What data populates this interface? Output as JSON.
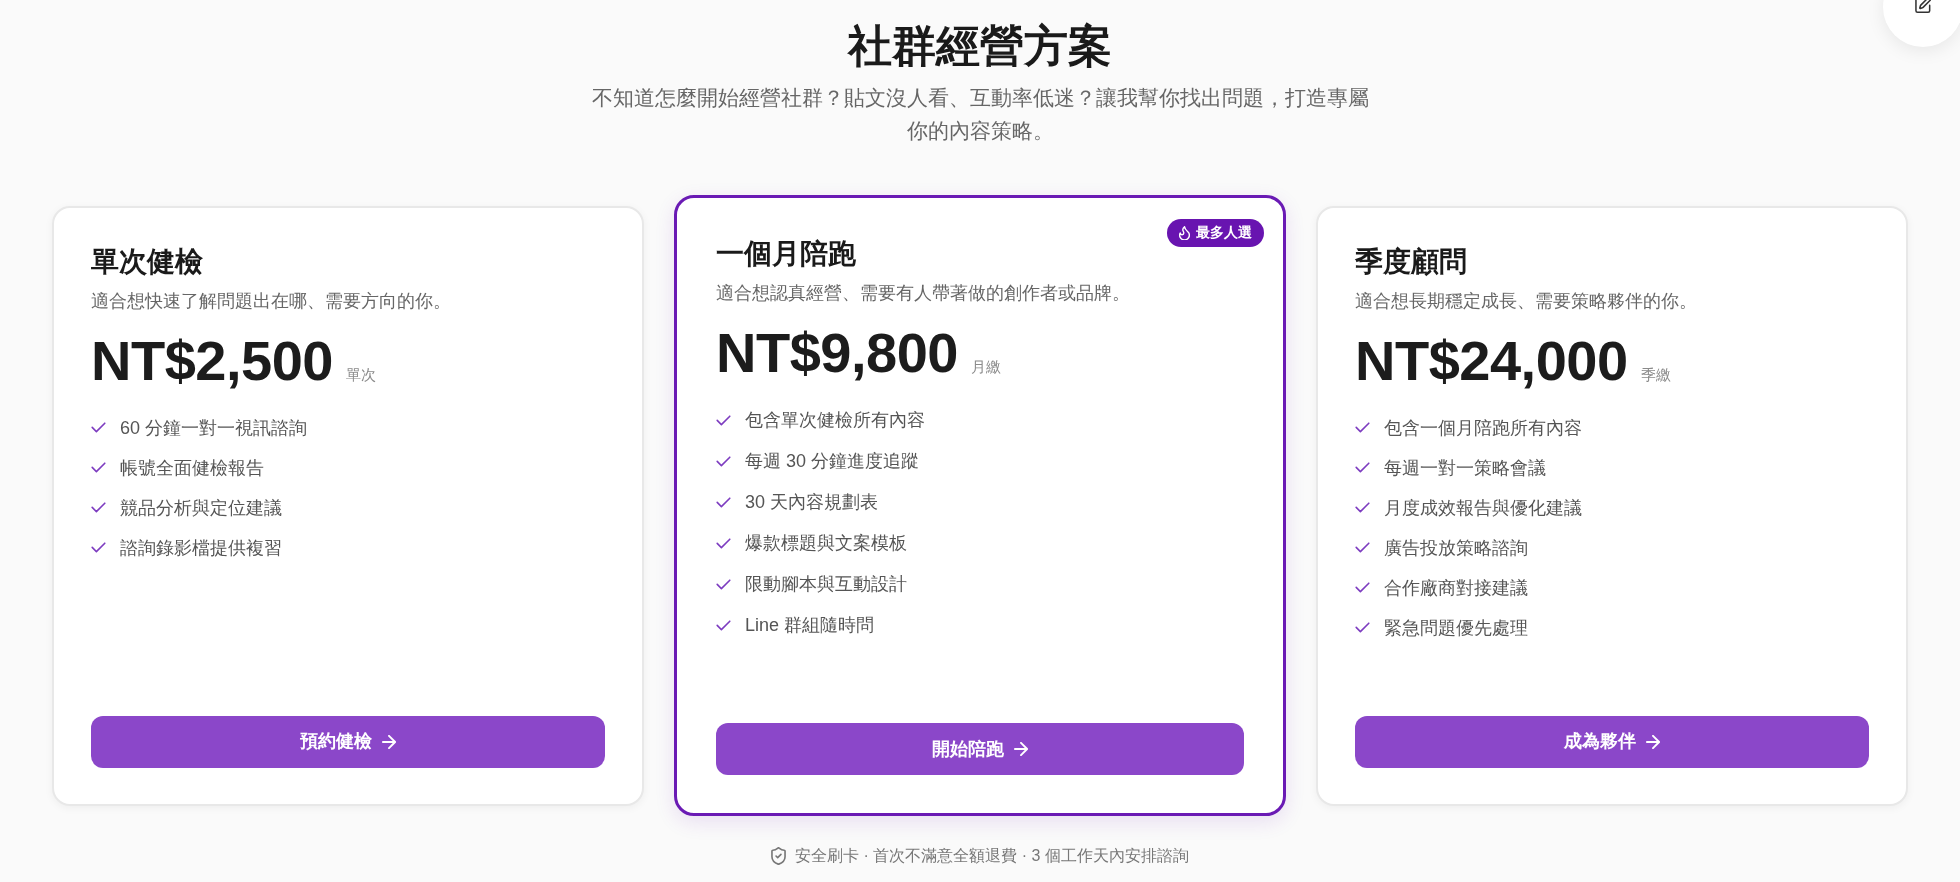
{
  "header": {
    "title": "社群經營方案",
    "subtitle": "不知道怎麼開始經營社群？貼文沒人看、互動率低迷？讓我幫你找出問題，打造專屬你的內容策略。"
  },
  "plans": [
    {
      "name": "單次健檢",
      "description": "適合想快速了解問題出在哪、需要方向的你。",
      "price": "NT$2,500",
      "unit": "單次",
      "features": [
        "60 分鐘一對一視訊諮詢",
        "帳號全面健檢報告",
        "競品分析與定位建議",
        "諮詢錄影檔提供複習"
      ],
      "button": "預約健檢",
      "featured": false
    },
    {
      "name": "一個月陪跑",
      "description": "適合想認真經營、需要有人帶著做的創作者或品牌。",
      "price": "NT$9,800",
      "unit": "月繳",
      "badge": "最多人選",
      "features": [
        "包含單次健檢所有內容",
        "每週 30 分鐘進度追蹤",
        "30 天內容規劃表",
        "爆款標題與文案模板",
        "限動腳本與互動設計",
        "Line 群組隨時問"
      ],
      "button": "開始陪跑",
      "featured": true
    },
    {
      "name": "季度顧問",
      "description": "適合想長期穩定成長、需要策略夥伴的你。",
      "price": "NT$24,000",
      "unit": "季繳",
      "features": [
        "包含一個月陪跑所有內容",
        "每週一對一策略會議",
        "月度成效報告與優化建議",
        "廣告投放策略諮詢",
        "合作廠商對接建議",
        "緊急問題優先處理"
      ],
      "button": "成為夥伴",
      "featured": false
    }
  ],
  "footer": {
    "note": "安全刷卡 · 首次不滿意全額退費 · 3 個工作天內安排諮詢"
  }
}
